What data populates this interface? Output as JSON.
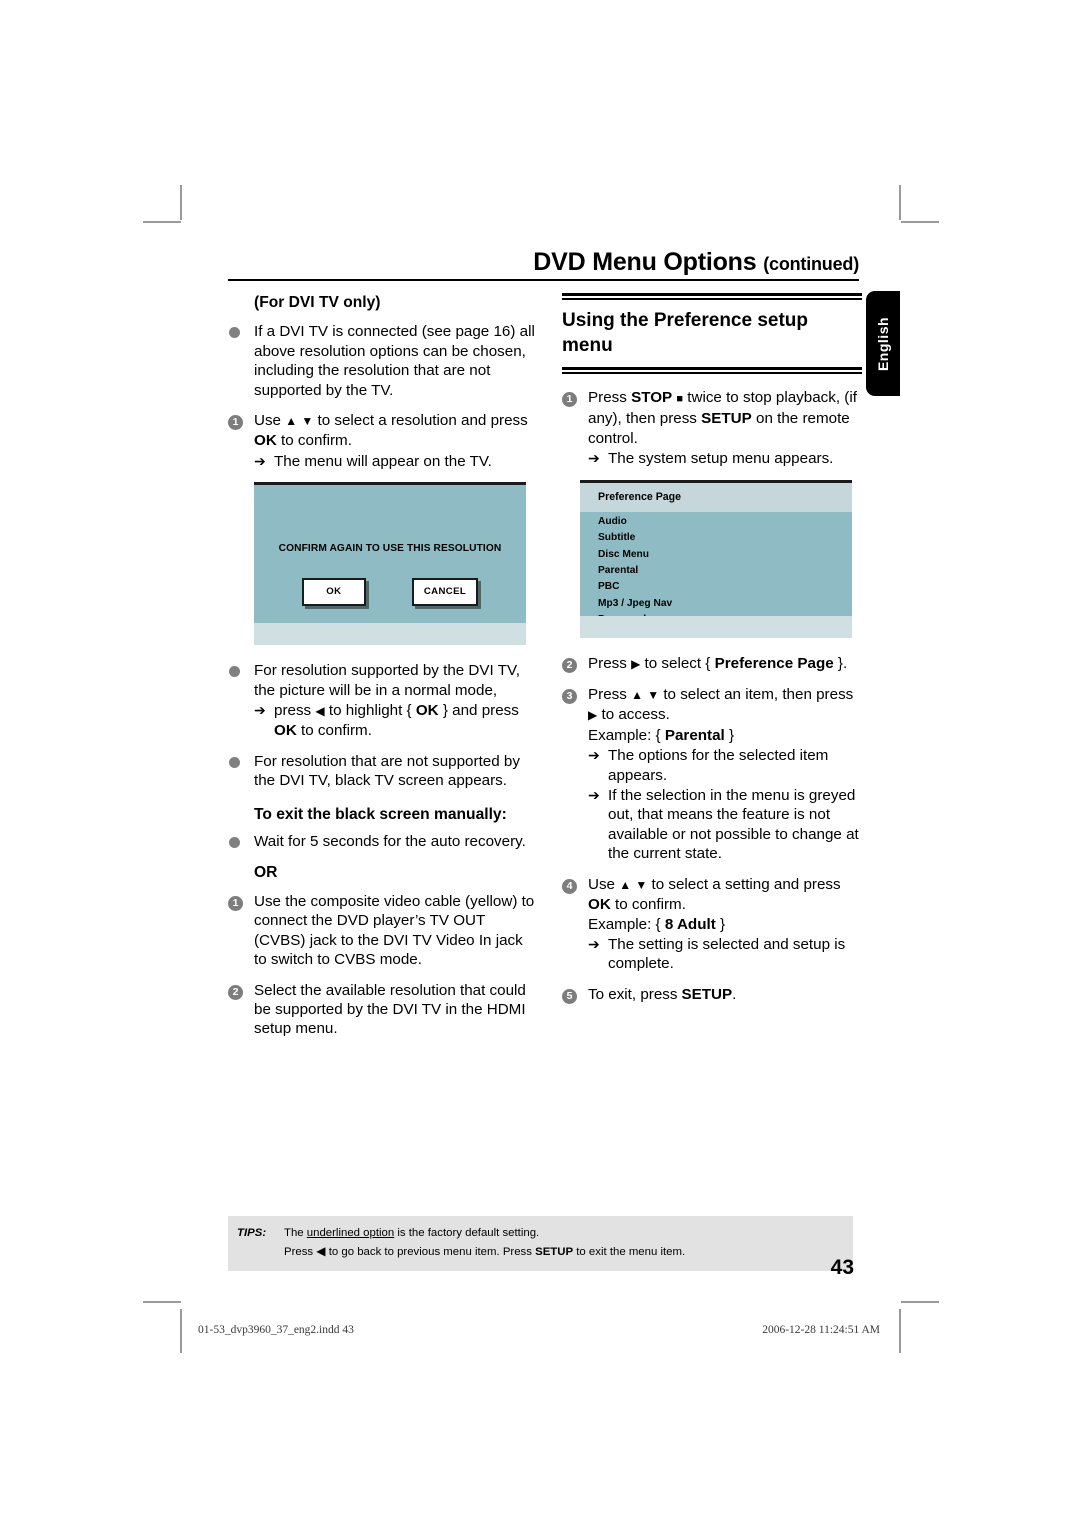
{
  "header": {
    "title": "DVD Menu Options",
    "continued": "(continued)",
    "language_tab": "English"
  },
  "left_column": {
    "subhead": "(For DVI TV only)",
    "bullet1": "If a DVI TV is connected (see page 16) all above resolution options can be chosen, including the resolution that are not supported by the TV.",
    "step1_a": "Use",
    "step1_up": "▲",
    "step1_down": "▼",
    "step1_b": "to select a resolution and press",
    "step1_ok": "OK",
    "step1_c": "to confirm.",
    "step1_arrow": "The menu will appear on the TV.",
    "tv_dialog": {
      "message": "CONFIRM AGAIN TO USE THIS RESOLUTION",
      "ok_button": "OK",
      "cancel_button": "CANCEL"
    },
    "bullet2_a": "For resolution supported by the DVI TV, the picture will be in a normal mode,",
    "bullet2_arrow_a": "press",
    "bullet2_arrow_left": "◀",
    "bullet2_arrow_b": "to highlight {",
    "bullet2_ok1": "OK",
    "bullet2_arrow_c": "} and press",
    "bullet2_ok2": "OK",
    "bullet2_arrow_d": "to confirm.",
    "bullet3": "For resolution that are not supported by the DVI TV, black TV screen appears.",
    "subhead2": "To exit the black screen manually:",
    "bullet4": "Wait for 5 seconds for the auto recovery.",
    "or_label": "OR",
    "step1_alt": "Use the composite video cable (yellow) to connect the DVD player’s TV OUT (CVBS) jack to the DVI TV Video In jack to switch to CVBS mode.",
    "step2_alt": "Select the available resolution that could be supported by the DVI TV in the HDMI setup menu."
  },
  "right_column": {
    "heading": "Using the Preference setup menu",
    "step1_a": "Press",
    "step1_stop": "STOP",
    "step1_square": "■",
    "step1_b": "twice to stop playback, (if any), then press",
    "step1_setup": "SETUP",
    "step1_c": "on the remote control.",
    "step1_arrow": "The system setup menu appears.",
    "preference_page": {
      "title": "Preference Page",
      "items": [
        "Audio",
        "Subtitle",
        "Disc Menu",
        "Parental",
        "PBC",
        "Mp3 / Jpeg Nav",
        "Password"
      ]
    },
    "step2_a": "Press",
    "step2_right": "▶",
    "step2_b": "to select {",
    "step2_label": "Preference Page",
    "step2_c": "}.",
    "step3_a": "Press",
    "step3_up": "▲",
    "step3_down": "▼",
    "step3_b": "to select an item, then press",
    "step3_right": "▶",
    "step3_c": "to access.",
    "step3_example_label": "Example: {",
    "step3_example_value": "Parental",
    "step3_example_close": "}",
    "step3_arrow1": "The options for the selected item appears.",
    "step3_arrow2": "If the selection in the menu is greyed out, that means the feature is not available or not possible to change at the current state.",
    "step4_a": "Use",
    "step4_up": "▲",
    "step4_down": "▼",
    "step4_b": "to select a setting and press",
    "step4_ok": "OK",
    "step4_c": "to confirm.",
    "step4_example_label": "Example: {",
    "step4_example_value": "8 Adult",
    "step4_example_close": "}",
    "step4_arrow": "The setting is selected and setup is complete.",
    "step5_a": "To exit, press",
    "step5_setup": "SETUP",
    "step5_b": "."
  },
  "markers": {
    "n1": "1",
    "n2": "2",
    "n3": "3",
    "n4": "4",
    "n5": "5",
    "arrow": "➔"
  },
  "tips": {
    "label": "TIPS:",
    "line1_a": "The ",
    "line1_underlined": "underlined option",
    "line1_b": " is the factory default setting.",
    "line2_a": "Press",
    "line2_left_arrow": "◀",
    "line2_b": "to go back to previous menu item. Press",
    "line2_setup": "SETUP",
    "line2_c": "to exit the menu item."
  },
  "page_number": "43",
  "print_footer": {
    "file": "01-53_dvp3960_37_eng2.indd   43",
    "timestamp": "2006-12-28   11:24:51 AM"
  }
}
